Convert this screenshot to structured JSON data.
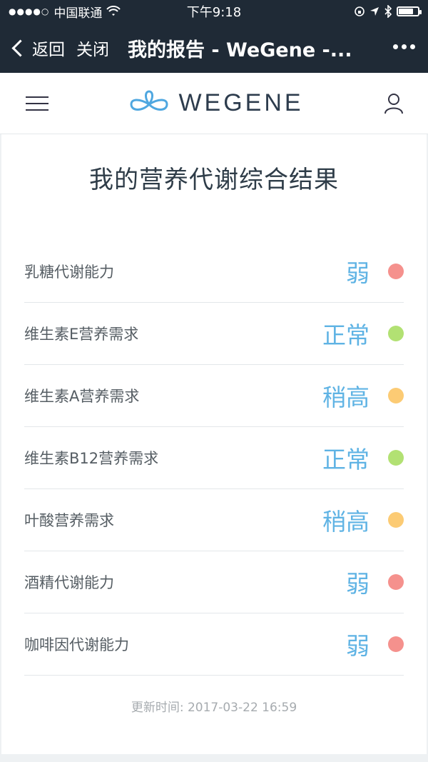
{
  "status_bar": {
    "carrier": "中国联通",
    "time": "下午9:18"
  },
  "nav": {
    "back_label": "返回",
    "close_label": "关闭",
    "title": "我的报告 - WeGene -..."
  },
  "app": {
    "brand": "WEGENE"
  },
  "report": {
    "title": "我的营养代谢综合结果",
    "items": [
      {
        "label": "乳糖代谢能力",
        "value": "弱",
        "color": "#f5918d"
      },
      {
        "label": "维生素E营养需求",
        "value": "正常",
        "color": "#b2e173"
      },
      {
        "label": "维生素A营养需求",
        "value": "稍高",
        "color": "#fccb74"
      },
      {
        "label": "维生素B12营养需求",
        "value": "正常",
        "color": "#b2e173"
      },
      {
        "label": "叶酸营养需求",
        "value": "稍高",
        "color": "#fccb74"
      },
      {
        "label": "酒精代谢能力",
        "value": "弱",
        "color": "#f5918d"
      },
      {
        "label": "咖啡因代谢能力",
        "value": "弱",
        "color": "#f5918d"
      }
    ],
    "updated": "更新时间: 2017-03-22 16:59"
  }
}
